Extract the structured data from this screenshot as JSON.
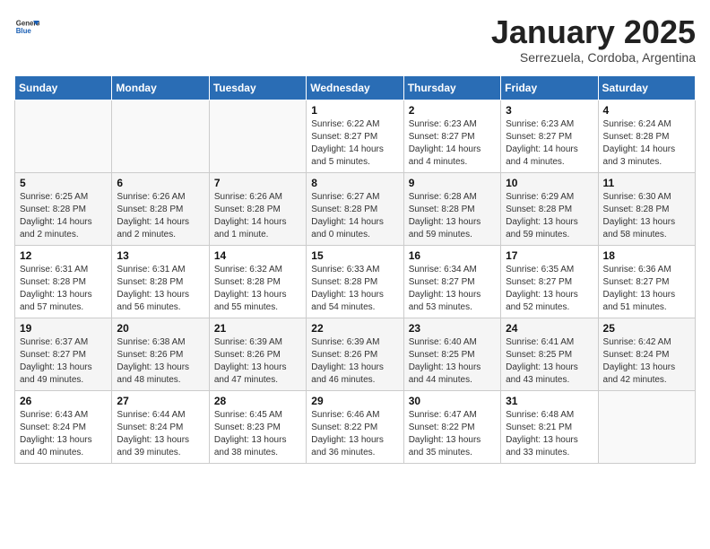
{
  "header": {
    "logo_general": "General",
    "logo_blue": "Blue",
    "month_title": "January 2025",
    "subtitle": "Serrezuela, Cordoba, Argentina"
  },
  "weekdays": [
    "Sunday",
    "Monday",
    "Tuesday",
    "Wednesday",
    "Thursday",
    "Friday",
    "Saturday"
  ],
  "weeks": [
    [
      {
        "day": "",
        "info": ""
      },
      {
        "day": "",
        "info": ""
      },
      {
        "day": "",
        "info": ""
      },
      {
        "day": "1",
        "info": "Sunrise: 6:22 AM\nSunset: 8:27 PM\nDaylight: 14 hours\nand 5 minutes."
      },
      {
        "day": "2",
        "info": "Sunrise: 6:23 AM\nSunset: 8:27 PM\nDaylight: 14 hours\nand 4 minutes."
      },
      {
        "day": "3",
        "info": "Sunrise: 6:23 AM\nSunset: 8:27 PM\nDaylight: 14 hours\nand 4 minutes."
      },
      {
        "day": "4",
        "info": "Sunrise: 6:24 AM\nSunset: 8:28 PM\nDaylight: 14 hours\nand 3 minutes."
      }
    ],
    [
      {
        "day": "5",
        "info": "Sunrise: 6:25 AM\nSunset: 8:28 PM\nDaylight: 14 hours\nand 2 minutes."
      },
      {
        "day": "6",
        "info": "Sunrise: 6:26 AM\nSunset: 8:28 PM\nDaylight: 14 hours\nand 2 minutes."
      },
      {
        "day": "7",
        "info": "Sunrise: 6:26 AM\nSunset: 8:28 PM\nDaylight: 14 hours\nand 1 minute."
      },
      {
        "day": "8",
        "info": "Sunrise: 6:27 AM\nSunset: 8:28 PM\nDaylight: 14 hours\nand 0 minutes."
      },
      {
        "day": "9",
        "info": "Sunrise: 6:28 AM\nSunset: 8:28 PM\nDaylight: 13 hours\nand 59 minutes."
      },
      {
        "day": "10",
        "info": "Sunrise: 6:29 AM\nSunset: 8:28 PM\nDaylight: 13 hours\nand 59 minutes."
      },
      {
        "day": "11",
        "info": "Sunrise: 6:30 AM\nSunset: 8:28 PM\nDaylight: 13 hours\nand 58 minutes."
      }
    ],
    [
      {
        "day": "12",
        "info": "Sunrise: 6:31 AM\nSunset: 8:28 PM\nDaylight: 13 hours\nand 57 minutes."
      },
      {
        "day": "13",
        "info": "Sunrise: 6:31 AM\nSunset: 8:28 PM\nDaylight: 13 hours\nand 56 minutes."
      },
      {
        "day": "14",
        "info": "Sunrise: 6:32 AM\nSunset: 8:28 PM\nDaylight: 13 hours\nand 55 minutes."
      },
      {
        "day": "15",
        "info": "Sunrise: 6:33 AM\nSunset: 8:28 PM\nDaylight: 13 hours\nand 54 minutes."
      },
      {
        "day": "16",
        "info": "Sunrise: 6:34 AM\nSunset: 8:27 PM\nDaylight: 13 hours\nand 53 minutes."
      },
      {
        "day": "17",
        "info": "Sunrise: 6:35 AM\nSunset: 8:27 PM\nDaylight: 13 hours\nand 52 minutes."
      },
      {
        "day": "18",
        "info": "Sunrise: 6:36 AM\nSunset: 8:27 PM\nDaylight: 13 hours\nand 51 minutes."
      }
    ],
    [
      {
        "day": "19",
        "info": "Sunrise: 6:37 AM\nSunset: 8:27 PM\nDaylight: 13 hours\nand 49 minutes."
      },
      {
        "day": "20",
        "info": "Sunrise: 6:38 AM\nSunset: 8:26 PM\nDaylight: 13 hours\nand 48 minutes."
      },
      {
        "day": "21",
        "info": "Sunrise: 6:39 AM\nSunset: 8:26 PM\nDaylight: 13 hours\nand 47 minutes."
      },
      {
        "day": "22",
        "info": "Sunrise: 6:39 AM\nSunset: 8:26 PM\nDaylight: 13 hours\nand 46 minutes."
      },
      {
        "day": "23",
        "info": "Sunrise: 6:40 AM\nSunset: 8:25 PM\nDaylight: 13 hours\nand 44 minutes."
      },
      {
        "day": "24",
        "info": "Sunrise: 6:41 AM\nSunset: 8:25 PM\nDaylight: 13 hours\nand 43 minutes."
      },
      {
        "day": "25",
        "info": "Sunrise: 6:42 AM\nSunset: 8:24 PM\nDaylight: 13 hours\nand 42 minutes."
      }
    ],
    [
      {
        "day": "26",
        "info": "Sunrise: 6:43 AM\nSunset: 8:24 PM\nDaylight: 13 hours\nand 40 minutes."
      },
      {
        "day": "27",
        "info": "Sunrise: 6:44 AM\nSunset: 8:24 PM\nDaylight: 13 hours\nand 39 minutes."
      },
      {
        "day": "28",
        "info": "Sunrise: 6:45 AM\nSunset: 8:23 PM\nDaylight: 13 hours\nand 38 minutes."
      },
      {
        "day": "29",
        "info": "Sunrise: 6:46 AM\nSunset: 8:22 PM\nDaylight: 13 hours\nand 36 minutes."
      },
      {
        "day": "30",
        "info": "Sunrise: 6:47 AM\nSunset: 8:22 PM\nDaylight: 13 hours\nand 35 minutes."
      },
      {
        "day": "31",
        "info": "Sunrise: 6:48 AM\nSunset: 8:21 PM\nDaylight: 13 hours\nand 33 minutes."
      },
      {
        "day": "",
        "info": ""
      }
    ]
  ]
}
